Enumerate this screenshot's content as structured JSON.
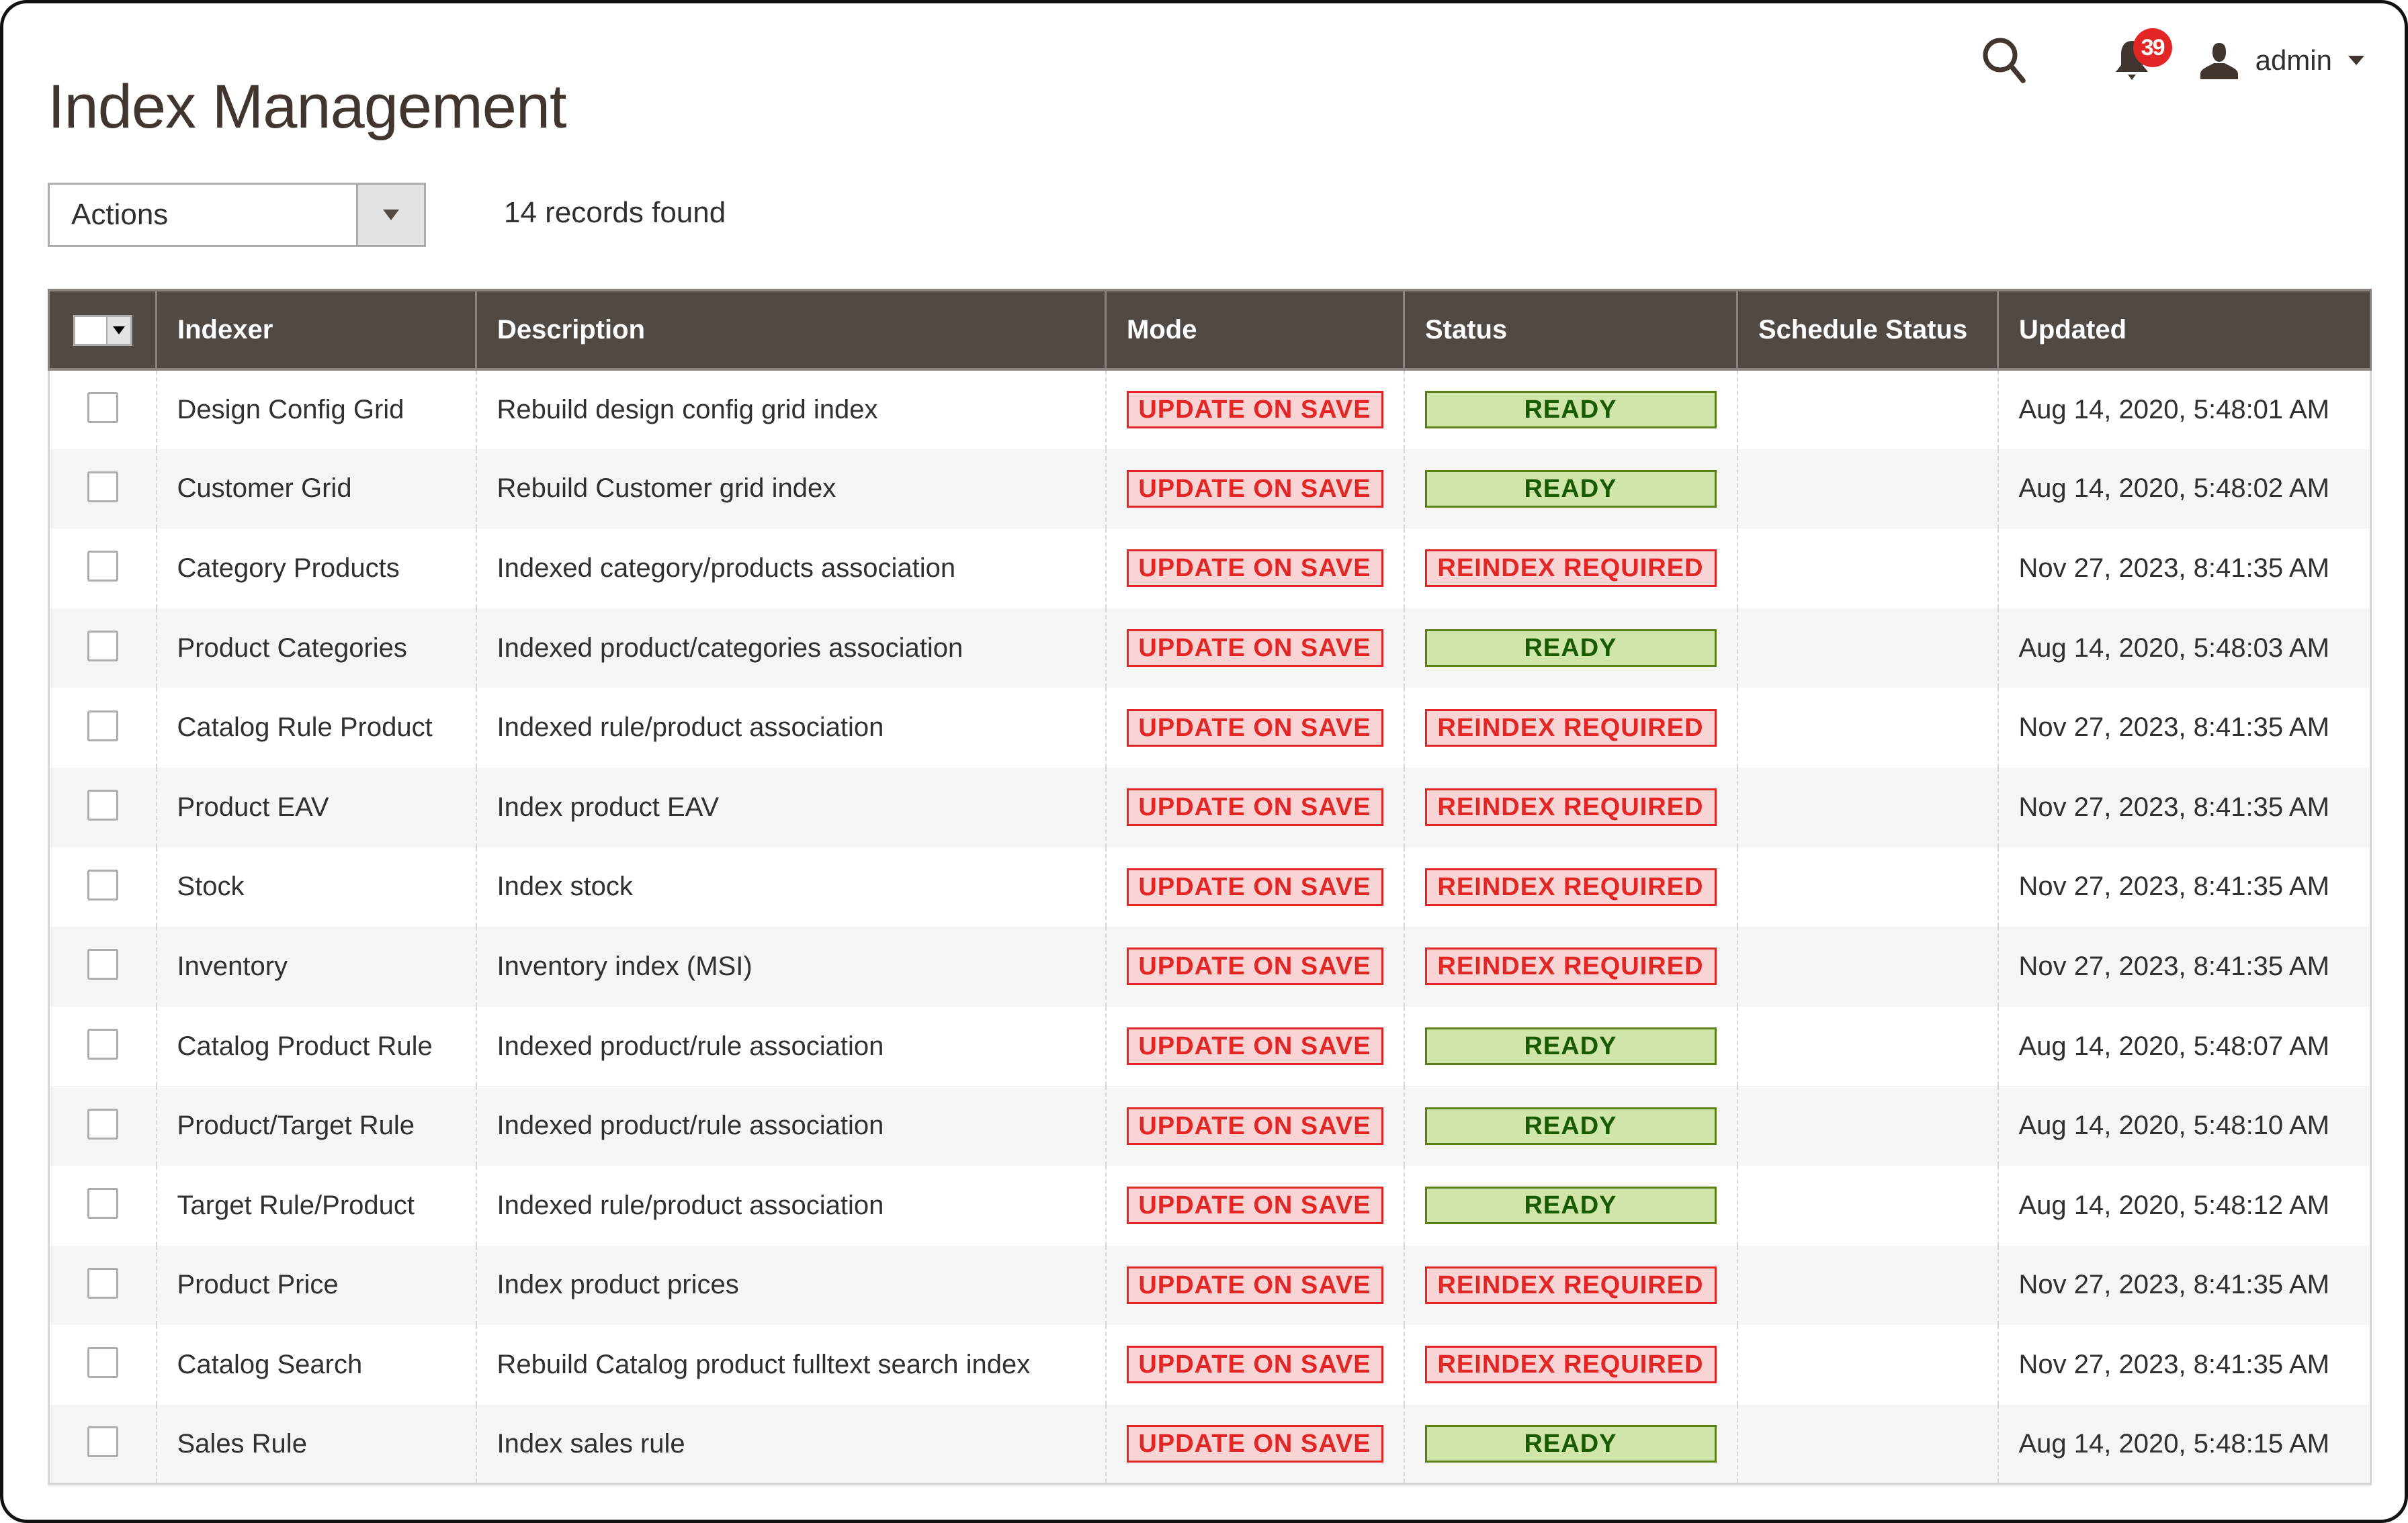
{
  "page": {
    "title": "Index Management"
  },
  "header": {
    "search_icon": "search-icon",
    "notifications": {
      "icon": "bell-icon",
      "count": "39"
    },
    "user": {
      "icon": "user-icon",
      "name": "admin",
      "caret": "caret-down-icon"
    }
  },
  "toolbar": {
    "actions_label": "Actions",
    "records_found": "14 records found"
  },
  "colors": {
    "header_bg": "#514943",
    "mode_red": "#e22626",
    "ready_green_text": "#185b00",
    "ready_green_bg": "#d0e5a9",
    "notification_badge": "#e22626"
  },
  "table": {
    "columns": [
      "",
      "Indexer",
      "Description",
      "Mode",
      "Status",
      "Schedule Status",
      "Updated"
    ],
    "rows": [
      {
        "indexer": "Design Config Grid",
        "description": "Rebuild design config grid index",
        "mode": "UPDATE ON SAVE",
        "status": "READY",
        "status_type": "ready",
        "schedule_status": "",
        "updated": "Aug 14, 2020, 5:48:01 AM"
      },
      {
        "indexer": "Customer Grid",
        "description": "Rebuild Customer grid index",
        "mode": "UPDATE ON SAVE",
        "status": "READY",
        "status_type": "ready",
        "schedule_status": "",
        "updated": "Aug 14, 2020, 5:48:02 AM"
      },
      {
        "indexer": "Category Products",
        "description": "Indexed category/products association",
        "mode": "UPDATE ON SAVE",
        "status": "REINDEX REQUIRED",
        "status_type": "reindex",
        "schedule_status": "",
        "updated": "Nov 27, 2023, 8:41:35 AM"
      },
      {
        "indexer": "Product Categories",
        "description": "Indexed product/categories association",
        "mode": "UPDATE ON SAVE",
        "status": "READY",
        "status_type": "ready",
        "schedule_status": "",
        "updated": "Aug 14, 2020, 5:48:03 AM"
      },
      {
        "indexer": "Catalog Rule Product",
        "description": "Indexed rule/product association",
        "mode": "UPDATE ON SAVE",
        "status": "REINDEX REQUIRED",
        "status_type": "reindex",
        "schedule_status": "",
        "updated": "Nov 27, 2023, 8:41:35 AM"
      },
      {
        "indexer": "Product EAV",
        "description": "Index product EAV",
        "mode": "UPDATE ON SAVE",
        "status": "REINDEX REQUIRED",
        "status_type": "reindex",
        "schedule_status": "",
        "updated": "Nov 27, 2023, 8:41:35 AM"
      },
      {
        "indexer": "Stock",
        "description": "Index stock",
        "mode": "UPDATE ON SAVE",
        "status": "REINDEX REQUIRED",
        "status_type": "reindex",
        "schedule_status": "",
        "updated": "Nov 27, 2023, 8:41:35 AM"
      },
      {
        "indexer": "Inventory",
        "description": "Inventory index (MSI)",
        "mode": "UPDATE ON SAVE",
        "status": "REINDEX REQUIRED",
        "status_type": "reindex",
        "schedule_status": "",
        "updated": "Nov 27, 2023, 8:41:35 AM"
      },
      {
        "indexer": "Catalog Product Rule",
        "description": "Indexed product/rule association",
        "mode": "UPDATE ON SAVE",
        "status": "READY",
        "status_type": "ready",
        "schedule_status": "",
        "updated": "Aug 14, 2020, 5:48:07 AM"
      },
      {
        "indexer": "Product/Target Rule",
        "description": "Indexed product/rule association",
        "mode": "UPDATE ON SAVE",
        "status": "READY",
        "status_type": "ready",
        "schedule_status": "",
        "updated": "Aug 14, 2020, 5:48:10 AM"
      },
      {
        "indexer": "Target Rule/Product",
        "description": "Indexed rule/product association",
        "mode": "UPDATE ON SAVE",
        "status": "READY",
        "status_type": "ready",
        "schedule_status": "",
        "updated": "Aug 14, 2020, 5:48:12 AM"
      },
      {
        "indexer": "Product Price",
        "description": "Index product prices",
        "mode": "UPDATE ON SAVE",
        "status": "REINDEX REQUIRED",
        "status_type": "reindex",
        "schedule_status": "",
        "updated": "Nov 27, 2023, 8:41:35 AM"
      },
      {
        "indexer": "Catalog Search",
        "description": "Rebuild Catalog product fulltext search index",
        "mode": "UPDATE ON SAVE",
        "status": "REINDEX REQUIRED",
        "status_type": "reindex",
        "schedule_status": "",
        "updated": "Nov 27, 2023, 8:41:35 AM"
      },
      {
        "indexer": "Sales Rule",
        "description": "Index sales rule",
        "mode": "UPDATE ON SAVE",
        "status": "READY",
        "status_type": "ready",
        "schedule_status": "",
        "updated": "Aug 14, 2020, 5:48:15 AM"
      }
    ]
  }
}
